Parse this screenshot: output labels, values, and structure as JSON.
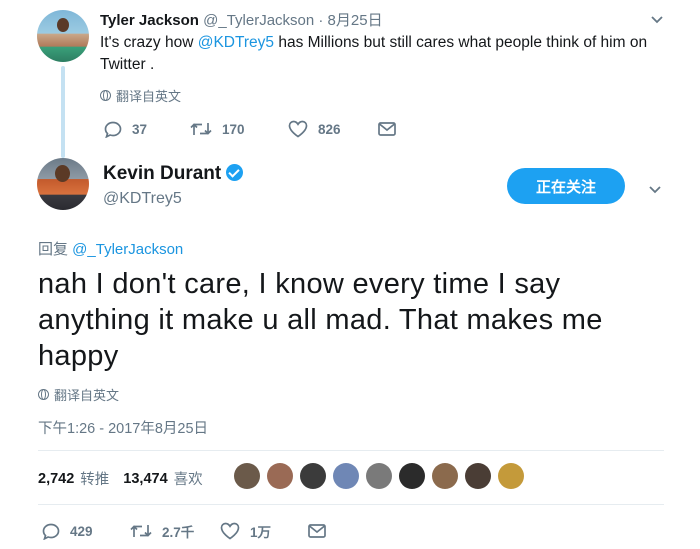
{
  "parent": {
    "name": "Tyler Jackson",
    "meta": " @_TylerJackson · 8月25日",
    "text_before": "It's crazy how ",
    "mention": "@KDTrey5",
    "text_after": " has Millions but still cares what people think of him on Twitter .",
    "translate": "翻译自英文",
    "replies": "37",
    "retweets": "170",
    "likes": "826"
  },
  "tweet": {
    "name": "Kevin Durant",
    "handle": "@KDTrey5",
    "follow_label": "正在关注",
    "reply_prefix": "回复 ",
    "reply_mention": "@_TylerJackson",
    "text": "nah I don't care, I know every time I say anything it make u all mad. That makes me happy",
    "translate": "翻译自英文",
    "timestamp": "下午1:26 - 2017年8月25日",
    "retweet_count": "2,742",
    "retweet_label": "转推",
    "like_count": "13,474",
    "like_label": "喜欢",
    "replies": "429",
    "retweets": "2.7千",
    "likes": "1万"
  },
  "likers": [
    "#6b5a4a",
    "#9a6a55",
    "#3b3b3b",
    "#6f87b5",
    "#7a7a7a",
    "#2b2b2b",
    "#8b6a4d",
    "#4a3d35",
    "#c49a3a"
  ],
  "colors": {
    "accent": "#1da1f2",
    "link": "#1b95e0",
    "muted": "#657786"
  }
}
